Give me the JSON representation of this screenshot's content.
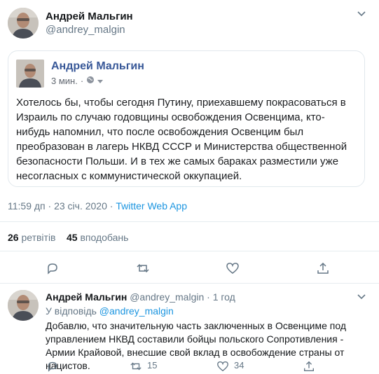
{
  "tweet": {
    "author_name": "Андрей Мальгин",
    "author_handle": "@andrey_malgin",
    "embedded_post": {
      "author_name": "Андрей Мальгин",
      "time": "3 мин.",
      "text": "Хотелось бы, чтобы сегодня Путину, приехавшему покрасоваться в Израиль по случаю годовщины освобождения Освенцима, кто-нибудь напомнил, что после освобождения Освенцим был преобразован в лагерь НКВД СССР и Министерства общественной безопасности Польши. И в тех же самых бараках разместили уже несогласных с коммунистической оккупацией."
    },
    "timestamp": "11:59 дп · 23 січ. 2020",
    "separator": " · ",
    "source": "Twitter Web App",
    "retweets_count": "26",
    "retweets_label": "ретвітів",
    "likes_count": "45",
    "likes_label": "вподобань"
  },
  "reply": {
    "author_name": "Андрей Мальгин",
    "author_handle": "@andrey_malgin",
    "time": "· 1 год",
    "reply_to_label": "У відповідь",
    "reply_to_handle": "@andrey_malgin",
    "text": "Добавлю, что значительную часть заключенных в Освенциме под управлением НКВД составили бойцы польского Сопротивления - Армии Крайовой, внесшие свой вклад в освобождение страны от нацистов.",
    "retweets_count": "15",
    "likes_count": "34"
  },
  "icons": {
    "reply": "reply-icon",
    "retweet": "retweet-icon",
    "like": "heart-icon",
    "share": "share-icon",
    "more": "chevron-down-icon",
    "globe": "globe-icon"
  },
  "colors": {
    "link": "#1b95e0",
    "fb_name": "#385898",
    "muted": "#657786",
    "divider": "#e6ecf0"
  }
}
